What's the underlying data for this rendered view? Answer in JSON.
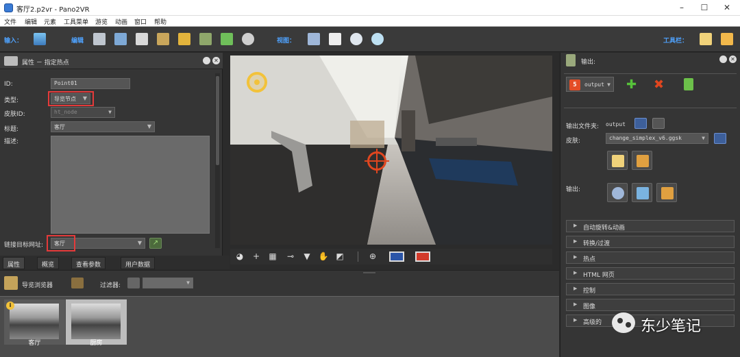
{
  "window": {
    "title": "客厅2.p2vr - Pano2VR",
    "controls": [
      "minimize-icon",
      "maximize-icon",
      "close-icon"
    ]
  },
  "menu": [
    "文件",
    "编辑",
    "元素",
    "工具菜单",
    "游览",
    "动画",
    "窗口",
    "帮助"
  ],
  "toolbar": {
    "input_label": "输入：",
    "edit_label": "编辑",
    "view_label": "视图：",
    "tools_label": "工具栏："
  },
  "properties": {
    "title": "属性 － 指定热点",
    "id_label": "ID:",
    "id_value": "Point01",
    "type_label": "类型:",
    "type_value": "导览节点",
    "skin_id_label": "皮肤ID:",
    "skin_id_value": "ht_node",
    "heading_label": "标题:",
    "heading_value": "客厅",
    "desc_label": "描述:",
    "link_label": "链接目标网址:",
    "link_value": "客厅"
  },
  "tabs": [
    "属性",
    "概览",
    "查看参数",
    "用户数据"
  ],
  "tour_browser": {
    "title": "导览浏览器",
    "filter_label": "过滤器:",
    "nodes": [
      {
        "label": "客厅",
        "selected": false
      },
      {
        "label": "厨房",
        "selected": true
      }
    ]
  },
  "output": {
    "title": "输出:",
    "format_value": "output",
    "folder_label": "输出文件夹:",
    "folder_value": "output",
    "skin_label": "皮肤:",
    "skin_value": "change_simplex_v6.ggsk",
    "output_label": "输出:",
    "sections": [
      "自动旋转&动画",
      "转换/过渡",
      "热点",
      "HTML 网页",
      "控制",
      "图像",
      "高级的"
    ]
  },
  "watermark": {
    "text": "东少笔记"
  },
  "colors": {
    "accent": "#4fa3ff",
    "highlight": "#e53a3a",
    "hotspot": "#f2c23a",
    "target": "#e0461f"
  }
}
